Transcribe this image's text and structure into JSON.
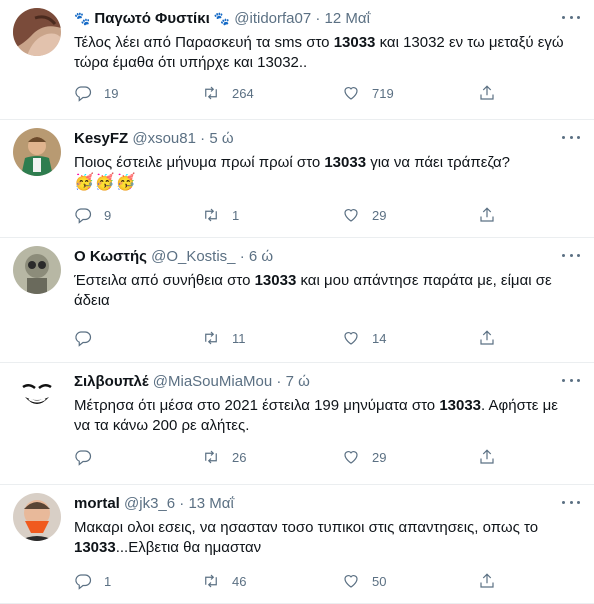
{
  "tweets": [
    {
      "name": "Παγωτό Φυστίκι",
      "name_prefix_emoji": "🐾",
      "name_suffix_emoji": "🐾",
      "handle": "@itidorfa07",
      "separator": "·",
      "time": "12 Μαΐ",
      "text_parts": [
        {
          "t": "Τέλος λέει από Παρασκευή τα sms στο ",
          "b": false
        },
        {
          "t": "13033",
          "b": true
        },
        {
          "t": " και 13032 εν τω μεταξύ εγώ τώρα έμαθα ότι υπήρχε και 13032..",
          "b": false
        }
      ],
      "emojis": "",
      "replies": "19",
      "retweets": "264",
      "likes": "719"
    },
    {
      "name": "KesyFZ",
      "name_prefix_emoji": "",
      "name_suffix_emoji": "",
      "handle": "@xsou81",
      "separator": "·",
      "time": "5 ώ",
      "text_parts": [
        {
          "t": "Ποιος έστειλε μήνυμα πρωί πρωί στο ",
          "b": false
        },
        {
          "t": "13033",
          "b": true
        },
        {
          "t": " για να πάει τράπεζα?",
          "b": false
        }
      ],
      "emojis": "🥳🥳🥳",
      "replies": "9",
      "retweets": "1",
      "likes": "29"
    },
    {
      "name": "Ο Κωστής",
      "name_prefix_emoji": "",
      "name_suffix_emoji": "",
      "handle": "@O_Kostis_",
      "separator": "·",
      "time": "6 ώ",
      "text_parts": [
        {
          "t": "Έστειλα από συνήθεια στο ",
          "b": false
        },
        {
          "t": "13033",
          "b": true
        },
        {
          "t": " και μου απάντησε παράτα με, είμαι σε άδεια",
          "b": false
        }
      ],
      "emojis": "",
      "replies": "",
      "retweets": "11",
      "likes": "14"
    },
    {
      "name": "Σιλβουπλέ",
      "name_prefix_emoji": "",
      "name_suffix_emoji": "",
      "handle": "@MiaSouMiaMou",
      "separator": "·",
      "time": "7 ώ",
      "text_parts": [
        {
          "t": "Μέτρησα ότι μέσα στο 2021 έστειλα 199 μηνύματα στο ",
          "b": false
        },
        {
          "t": "13033",
          "b": true
        },
        {
          "t": ". Αφήστε με να τα κάνω 200 ρε αλήτες.",
          "b": false
        }
      ],
      "emojis": "",
      "replies": "",
      "retweets": "26",
      "likes": "29"
    },
    {
      "name": "mortal",
      "name_prefix_emoji": "",
      "name_suffix_emoji": "",
      "handle": "@jk3_6",
      "separator": "·",
      "time": "13 Μαΐ",
      "text_parts": [
        {
          "t": "Μακαρι ολοι εσεις, να ησασταν τοσο τυπικοι στις απαντησεις, οπως το ",
          "b": false
        },
        {
          "t": "13033",
          "b": true
        },
        {
          "t": "...Ελβετια θα ημασταν",
          "b": false
        }
      ],
      "emojis": "",
      "replies": "1",
      "retweets": "46",
      "likes": "50"
    }
  ],
  "icons": {
    "reply": "reply-icon",
    "retweet": "retweet-icon",
    "like": "heart-icon",
    "share": "share-icon",
    "more": "more-options-icon"
  },
  "colors": {
    "text": "#0f1419",
    "secondary": "#5b7083",
    "divider": "#ebeef0"
  }
}
